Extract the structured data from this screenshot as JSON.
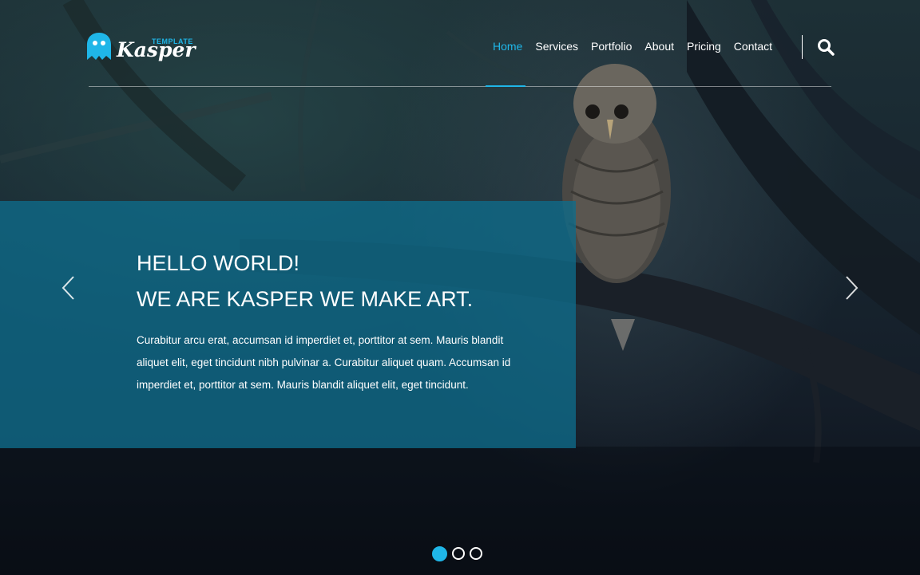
{
  "brand": {
    "name": "Kasper",
    "tag": "TEMPLATE",
    "accent": "#1fb6e8"
  },
  "nav": {
    "items": [
      {
        "label": "Home",
        "active": true
      },
      {
        "label": "Services",
        "active": false
      },
      {
        "label": "Portfolio",
        "active": false
      },
      {
        "label": "About",
        "active": false
      },
      {
        "label": "Pricing",
        "active": false
      },
      {
        "label": "Contact",
        "active": false
      }
    ],
    "search_icon": "search-icon"
  },
  "slide": {
    "title_line1": "HELLO WORLD!",
    "title_line2": "WE ARE KASPER WE MAKE ART.",
    "text": "Curabitur arcu erat, accumsan id imperdiet et, porttitor at sem. Mauris blandit aliquet elit, eget tincidunt nibh pulvinar a. Curabitur aliquet quam. Accumsan id imperdiet et, porttitor at sem. Mauris blandit aliquet elit, eget tincidunt.",
    "prev_icon": "chevron-left-icon",
    "next_icon": "chevron-right-icon",
    "panel_color": "#0e6c8a"
  },
  "pagination": {
    "count": 3,
    "active_index": 0
  }
}
